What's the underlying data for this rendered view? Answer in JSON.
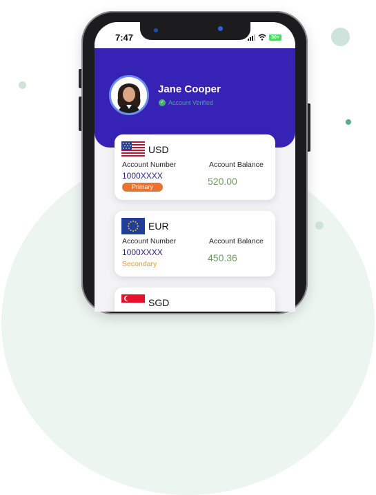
{
  "status_bar": {
    "time": "7:47",
    "battery": "30+"
  },
  "profile": {
    "name": "Jane Cooper",
    "verified_text": "Account Verified"
  },
  "accounts": [
    {
      "currency": "USD",
      "flag": "us-flag",
      "number_label": "Account Number",
      "number": "1000XXXX",
      "balance_label": "Account Balance",
      "balance": "520.00",
      "tag": "Primary"
    },
    {
      "currency": "EUR",
      "flag": "eu-flag",
      "number_label": "Account Number",
      "number": "1000XXXX",
      "balance_label": "Account Balance",
      "balance": "450.36",
      "tag": "Secondary"
    },
    {
      "currency": "SGD",
      "flag": "sg-flag"
    }
  ],
  "colors": {
    "header": "#3622b4",
    "primary_tag": "#e8722f",
    "secondary_tag": "#e89a1f",
    "balance": "#6b9b5c",
    "verified": "#4caf6e"
  }
}
